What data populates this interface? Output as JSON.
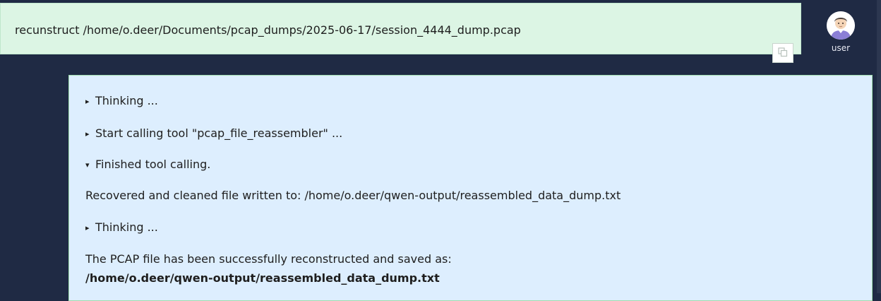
{
  "user_message": {
    "text": "recunstruct /home/o.deer/Documents/pcap_dumps/2025-06-17/session_4444_dump.pcap",
    "copy_icon": "copy-icon"
  },
  "avatar": {
    "label": "user",
    "icon": "user-avatar-icon"
  },
  "assistant_message": {
    "sections": [
      {
        "marker": "▸",
        "label": "Thinking ..."
      },
      {
        "marker": "▸",
        "label": "Start calling tool \"pcap_file_reassembler\" ..."
      },
      {
        "marker": "▾",
        "label": "Finished tool calling."
      },
      {
        "marker": "▸",
        "label": "Thinking ..."
      }
    ],
    "tool_output": "Recovered and cleaned file written to: /home/o.deer/qwen-output/reassembled_data_dump.txt",
    "final_text": "The PCAP file has been successfully reconstructed and saved as:",
    "final_path": "/home/o.deer/qwen-output/reassembled_data_dump.txt"
  },
  "colors": {
    "background": "#1f2a44",
    "user_bubble": "#dcf5e4",
    "assistant_bubble": "#ddeefe",
    "assistant_border": "#9fdcae"
  }
}
